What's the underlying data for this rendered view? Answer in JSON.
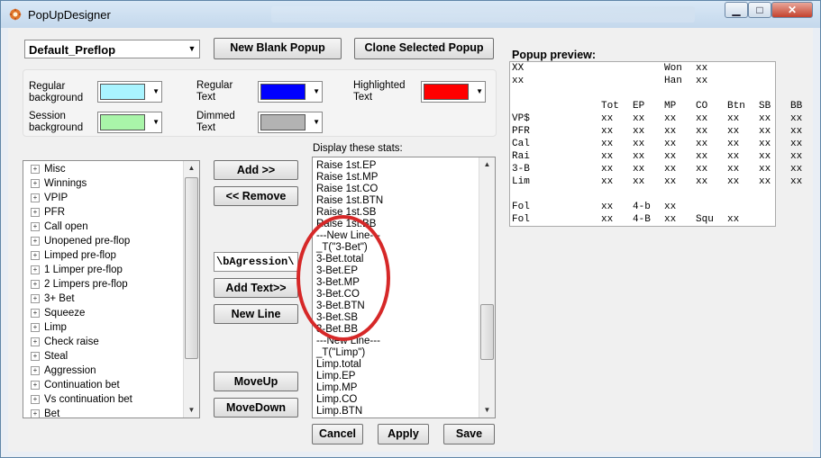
{
  "window": {
    "title": "PopUpDesigner",
    "minimize_label": "▁",
    "maximize_label": "□",
    "close_label": "✕"
  },
  "preset_combo": {
    "value": "Default_Preflop"
  },
  "toolbar": {
    "new_blank_popup": "New Blank Popup",
    "clone_selected_popup": "Clone Selected Popup"
  },
  "colors": {
    "regular_background": {
      "label": "Regular background",
      "color": "#a9f4ff"
    },
    "session_background": {
      "label": "Session background",
      "color": "#a9f5a9"
    },
    "regular_text": {
      "label": "Regular Text",
      "color": "#0000ff"
    },
    "dimmed_text": {
      "label": "Dimmed Text",
      "color": "#b3b3b3"
    },
    "highlighted_text": {
      "label": "Highlighted Text",
      "color": "#ff0000"
    }
  },
  "stat_tree": [
    "Misc",
    "Winnings",
    "VPIP",
    "PFR",
    "Call open",
    "Unopened pre-flop",
    "Limped pre-flop",
    "1 Limper pre-flop",
    "2 Limpers pre-flop",
    "3+ Bet",
    "Squeeze",
    "Limp",
    "Check raise",
    "Steal",
    "Aggression",
    "Continuation bet",
    "Vs continuation bet",
    "Bet"
  ],
  "buttons": {
    "add": "Add >>",
    "remove": "<< Remove",
    "add_text": "Add Text>>",
    "new_line": "New Line",
    "move_up": "MoveUp",
    "move_down": "MoveDown",
    "cancel": "Cancel",
    "apply": "Apply",
    "save": "Save"
  },
  "text_input": {
    "value": "\\bAgression\\"
  },
  "display_stats": {
    "label": "Display these stats:",
    "items": [
      "Raise 1st.EP",
      "Raise 1st.MP",
      "Raise 1st.CO",
      "Raise 1st.BTN",
      "Raise 1st.SB",
      "Raise 1st.BB",
      "---New Line---",
      "_T(\"3-Bet\")",
      "3-Bet.total",
      "3-Bet.EP",
      "3-Bet.MP",
      "3-Bet.CO",
      "3-Bet.BTN",
      "3-Bet.SB",
      "3-Bet.BB",
      "---New Line---",
      "_T(\"Limp\")",
      "Limp.total",
      "Limp.EP",
      "Limp.MP",
      "Limp.CO",
      "Limp.BTN"
    ]
  },
  "preview": {
    "label": "Popup preview:",
    "rows": [
      [
        "XX",
        "",
        "",
        "Won",
        "xx",
        "",
        "",
        "",
        ""
      ],
      [
        "xx",
        "",
        "",
        "Han",
        "xx",
        "",
        "",
        "",
        ""
      ],
      [
        "",
        "",
        "",
        "",
        "",
        "",
        "",
        "",
        ""
      ],
      [
        "",
        "Tot",
        "EP",
        "MP",
        "CO",
        "Btn",
        "SB",
        "BB",
        ""
      ],
      [
        "VP$",
        "xx",
        "xx",
        "xx",
        "xx",
        "xx",
        "xx",
        "xx",
        ""
      ],
      [
        "PFR",
        "xx",
        "xx",
        "xx",
        "xx",
        "xx",
        "xx",
        "xx",
        ""
      ],
      [
        "Cal",
        "xx",
        "xx",
        "xx",
        "xx",
        "xx",
        "xx",
        "xx",
        ""
      ],
      [
        "Rai",
        "xx",
        "xx",
        "xx",
        "xx",
        "xx",
        "xx",
        "xx",
        ""
      ],
      [
        "3-B",
        "xx",
        "xx",
        "xx",
        "xx",
        "xx",
        "xx",
        "xx",
        ""
      ],
      [
        "Lim",
        "xx",
        "xx",
        "xx",
        "xx",
        "xx",
        "xx",
        "xx",
        ""
      ],
      [
        "",
        "",
        "",
        "",
        "",
        "",
        "",
        "",
        ""
      ],
      [
        "Fol",
        "xx",
        "4-b",
        "xx",
        "",
        "",
        "",
        "",
        ""
      ],
      [
        "Fol",
        "xx",
        "4-B",
        "xx",
        "Squ",
        "xx",
        "",
        "",
        ""
      ]
    ]
  }
}
